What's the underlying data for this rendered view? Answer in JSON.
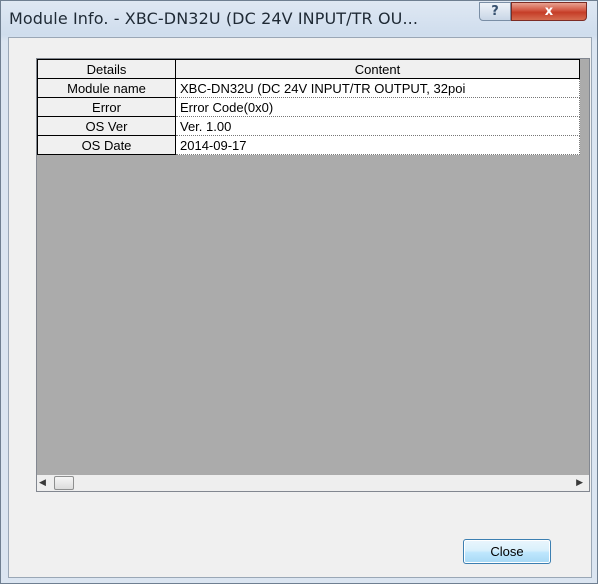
{
  "window": {
    "title": "Module Info. - XBC-DN32U (DC 24V INPUT/TR OU...",
    "help_button": "?",
    "close_button": "x"
  },
  "table": {
    "columns": [
      "Details",
      "Content"
    ],
    "rows": [
      {
        "label": "Module name",
        "value": "XBC-DN32U (DC 24V INPUT/TR OUTPUT, 32poi"
      },
      {
        "label": "Error",
        "value": "Error Code(0x0)"
      },
      {
        "label": "OS Ver",
        "value": "Ver. 1.00"
      },
      {
        "label": "OS Date",
        "value": "2014-09-17"
      }
    ]
  },
  "scrollbar": {
    "left_arrow": "◀",
    "right_arrow": "▶"
  },
  "footer": {
    "close_label": "Close"
  }
}
